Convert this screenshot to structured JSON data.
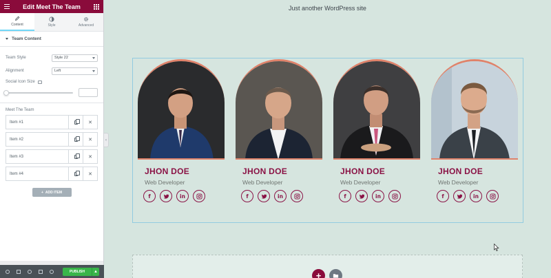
{
  "panel": {
    "title": "Edit Meet The Team",
    "tabs": [
      {
        "label": "Content",
        "icon": "pencil-icon",
        "active": true
      },
      {
        "label": "Style",
        "icon": "contrast-icon",
        "active": false
      },
      {
        "label": "Advanced",
        "icon": "gear-icon",
        "active": false
      }
    ],
    "section_title": "Team Content",
    "team_style": {
      "label": "Team Style",
      "value": "Style 22"
    },
    "alignment": {
      "label": "Alignment",
      "value": "Left"
    },
    "social_icon_size": {
      "label": "Social Icon Size",
      "value": ""
    },
    "repeater": {
      "title": "Meet The Team",
      "items": [
        "Item #1",
        "Item #2",
        "Item #3",
        "Item #4"
      ],
      "add_label": "ADD ITEM"
    },
    "footer": {
      "publish_label": "PUBLISH",
      "more_label": "▲"
    }
  },
  "preview": {
    "tagline": "Just another WordPress site",
    "members": [
      {
        "name": "JHON DOE",
        "role": "Web Developer",
        "socials": [
          "facebook-icon",
          "twitter-icon",
          "linkedin-icon",
          "instagram-icon"
        ]
      },
      {
        "name": "JHON DOE",
        "role": "Web Developer",
        "socials": [
          "facebook-icon",
          "twitter-icon",
          "linkedin-icon",
          "instagram-icon"
        ]
      },
      {
        "name": "JHON DOE",
        "role": "Web Developer",
        "socials": [
          "facebook-icon",
          "twitter-icon",
          "linkedin-icon",
          "instagram-icon"
        ]
      },
      {
        "name": "JHON DOE",
        "role": "Web Developer",
        "socials": [
          "facebook-icon",
          "twitter-icon",
          "linkedin-icon",
          "instagram-icon"
        ]
      }
    ]
  },
  "colors": {
    "brand": "#8a0b3b",
    "accent": "#8a1245",
    "photo_border": "#e0826a",
    "publish": "#39b54a",
    "canvas": "#d6e5df"
  }
}
